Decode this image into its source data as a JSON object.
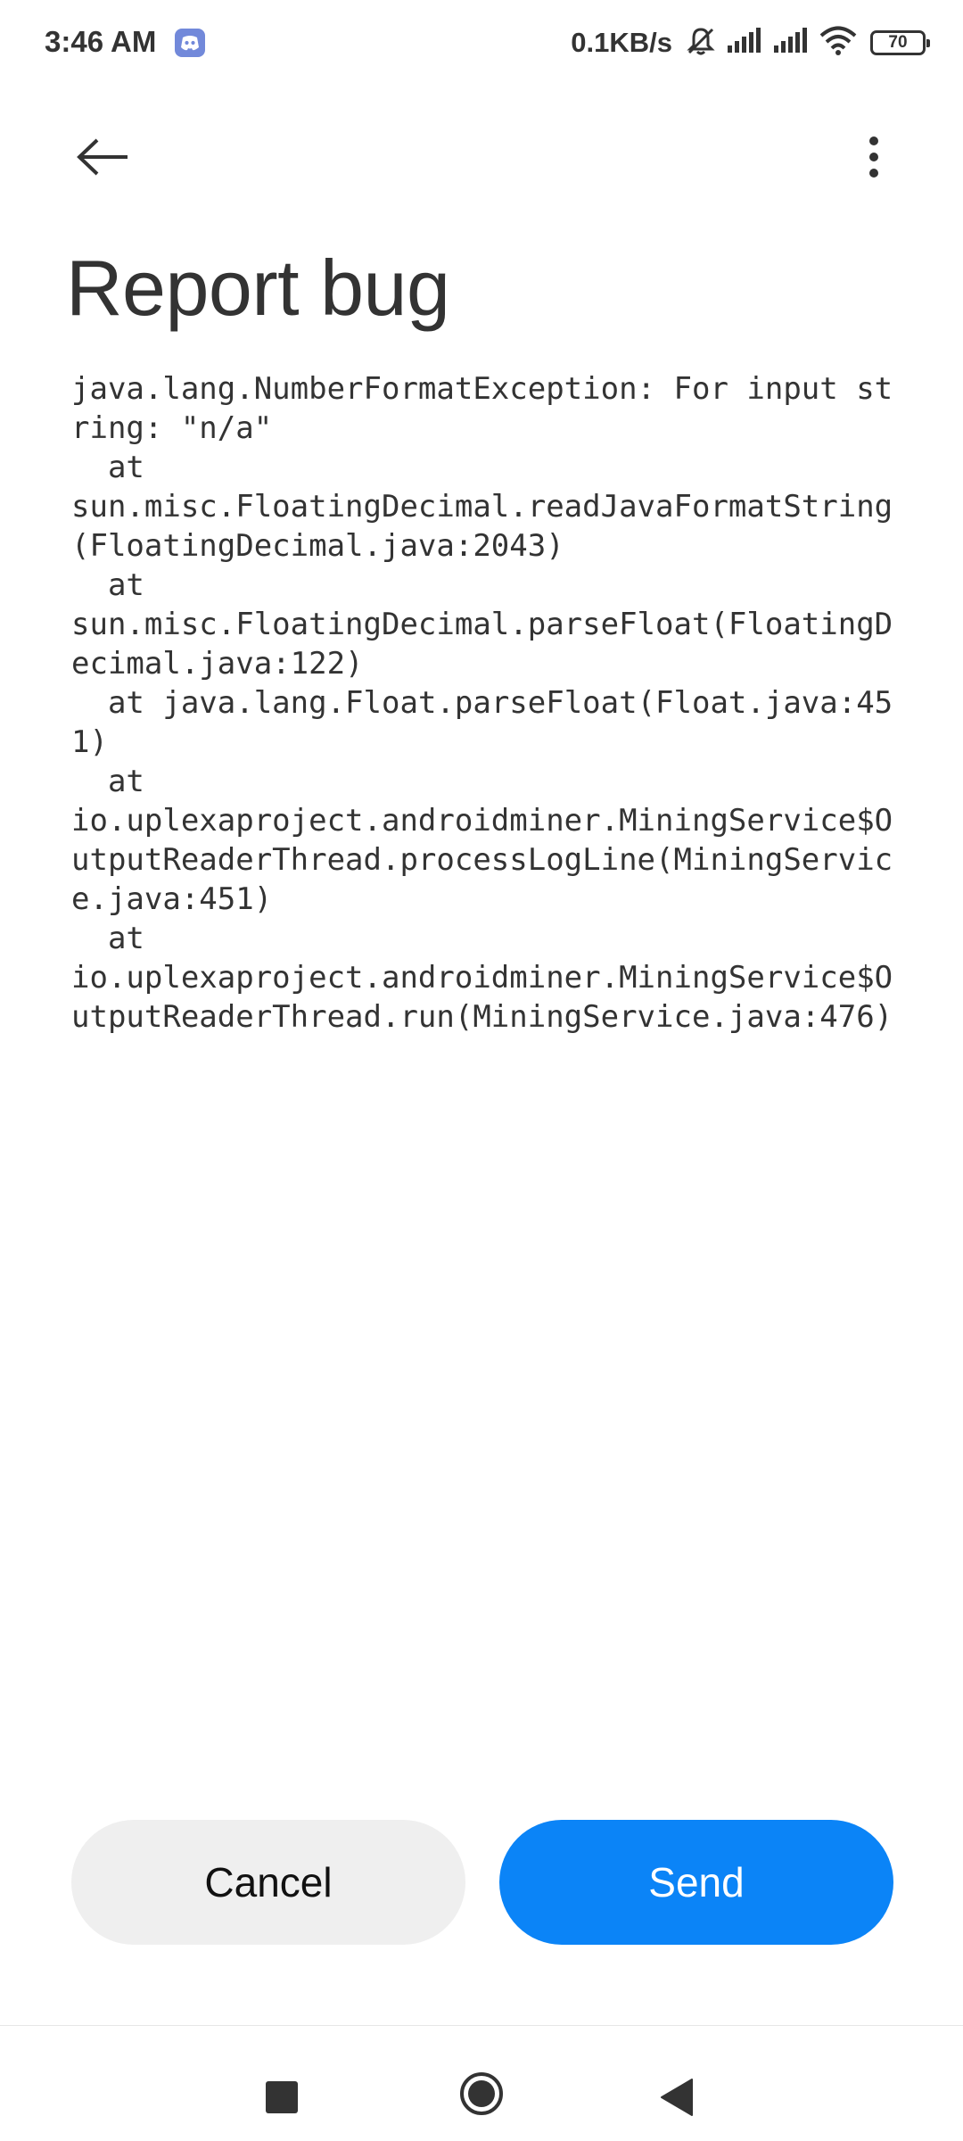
{
  "status_bar": {
    "time": "3:46 AM",
    "network_speed": "0.1KB/s",
    "battery_level": "70",
    "icons": [
      "discord-icon",
      "mute-bell-icon",
      "signal-icon",
      "signal-icon",
      "wifi-icon",
      "battery-icon"
    ]
  },
  "app_bar": {
    "back_icon": "arrow-left-icon",
    "menu_icon": "more-vertical-icon"
  },
  "page": {
    "title": "Report bug",
    "report_text": "java.lang.NumberFormatException: For input string: \"n/a\"\n  at\nsun.misc.FloatingDecimal.readJavaFormatString(FloatingDecimal.java:2043)\n  at\nsun.misc.FloatingDecimal.parseFloat(FloatingDecimal.java:122)\n  at java.lang.Float.parseFloat(Float.java:451)\n  at\nio.uplexaproject.androidminer.MiningService$OutputReaderThread.processLogLine(MiningService.java:451)\n  at\nio.uplexaproject.androidminer.MiningService$OutputReaderThread.run(MiningService.java:476)"
  },
  "actions": {
    "cancel_label": "Cancel",
    "send_label": "Send"
  },
  "colors": {
    "send_button": "#0b84f7",
    "cancel_button": "#efefef",
    "text": "#333333"
  },
  "nav_bar": {
    "icons": [
      "recents-square-icon",
      "home-circle-icon",
      "back-triangle-icon"
    ]
  }
}
